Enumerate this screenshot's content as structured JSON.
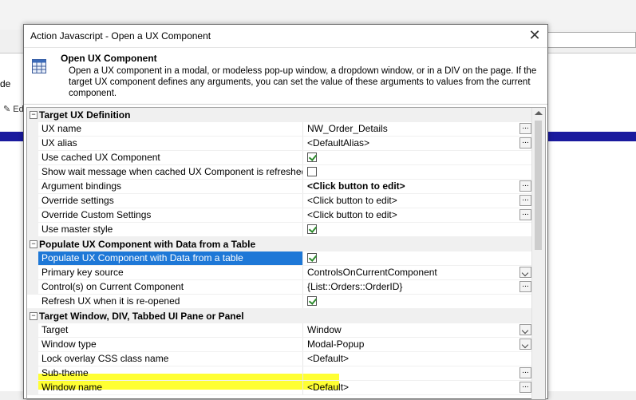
{
  "background": {
    "left_label": "de",
    "toolbar_label": "Ed"
  },
  "dialog": {
    "title": "Action Javascript - Open a UX Component",
    "close_glyph": "✕",
    "header_title": "Open UX Component",
    "header_description": "Open a UX component in a modal, or modeless pop-up window, a dropdown window, or in a DIV on the page. If the target UX component defines any arguments, you can set the value of these arguments to values from the current component.",
    "header_icon": "grid-table-icon"
  },
  "grid": {
    "categories": {
      "target_ux": "Target UX Definition",
      "populate": "Populate UX Component with Data from a Table",
      "target_window": "Target Window, DIV, Tabbed UI Pane or Panel"
    },
    "rows": {
      "ux_name": {
        "label": "UX name",
        "value": "NW_Order_Details"
      },
      "ux_alias": {
        "label": "UX alias",
        "value": "<DefaultAlias>"
      },
      "use_cached": {
        "label": "Use cached UX Component",
        "checked": true
      },
      "show_wait": {
        "label": "Show wait message when cached UX Component is refreshed",
        "checked": false
      },
      "argument_bindings": {
        "label": "Argument bindings",
        "value": "<Click button to edit>"
      },
      "override_settings": {
        "label": "Override settings",
        "value": "<Click button to edit>"
      },
      "override_custom": {
        "label": "Override Custom Settings",
        "value": "<Click button to edit>"
      },
      "use_master": {
        "label": "Use master style",
        "checked": true
      },
      "populate_data": {
        "label": "Populate UX Component with Data from a table",
        "checked": true
      },
      "primary_key": {
        "label": "Primary key source",
        "value": "ControlsOnCurrentComponent"
      },
      "controls_current": {
        "label": "Control(s) on Current Component",
        "value": "{List::Orders::OrderID}"
      },
      "refresh_ux": {
        "label": "Refresh UX when it is re-opened",
        "checked": true
      },
      "target": {
        "label": "Target",
        "value": "Window"
      },
      "window_type": {
        "label": "Window type",
        "value": "Modal-Popup"
      },
      "lock_overlay": {
        "label": "Lock overlay CSS class name",
        "value": "<Default>"
      },
      "sub_theme": {
        "label": "Sub-theme",
        "value": ""
      },
      "window_name": {
        "label": "Window name",
        "value": "<Default>"
      }
    },
    "ellipsis_glyph": "...",
    "toggle_glyph": "−",
    "highlight_color": "#ffff33",
    "selection_color": "#1e78d7"
  }
}
